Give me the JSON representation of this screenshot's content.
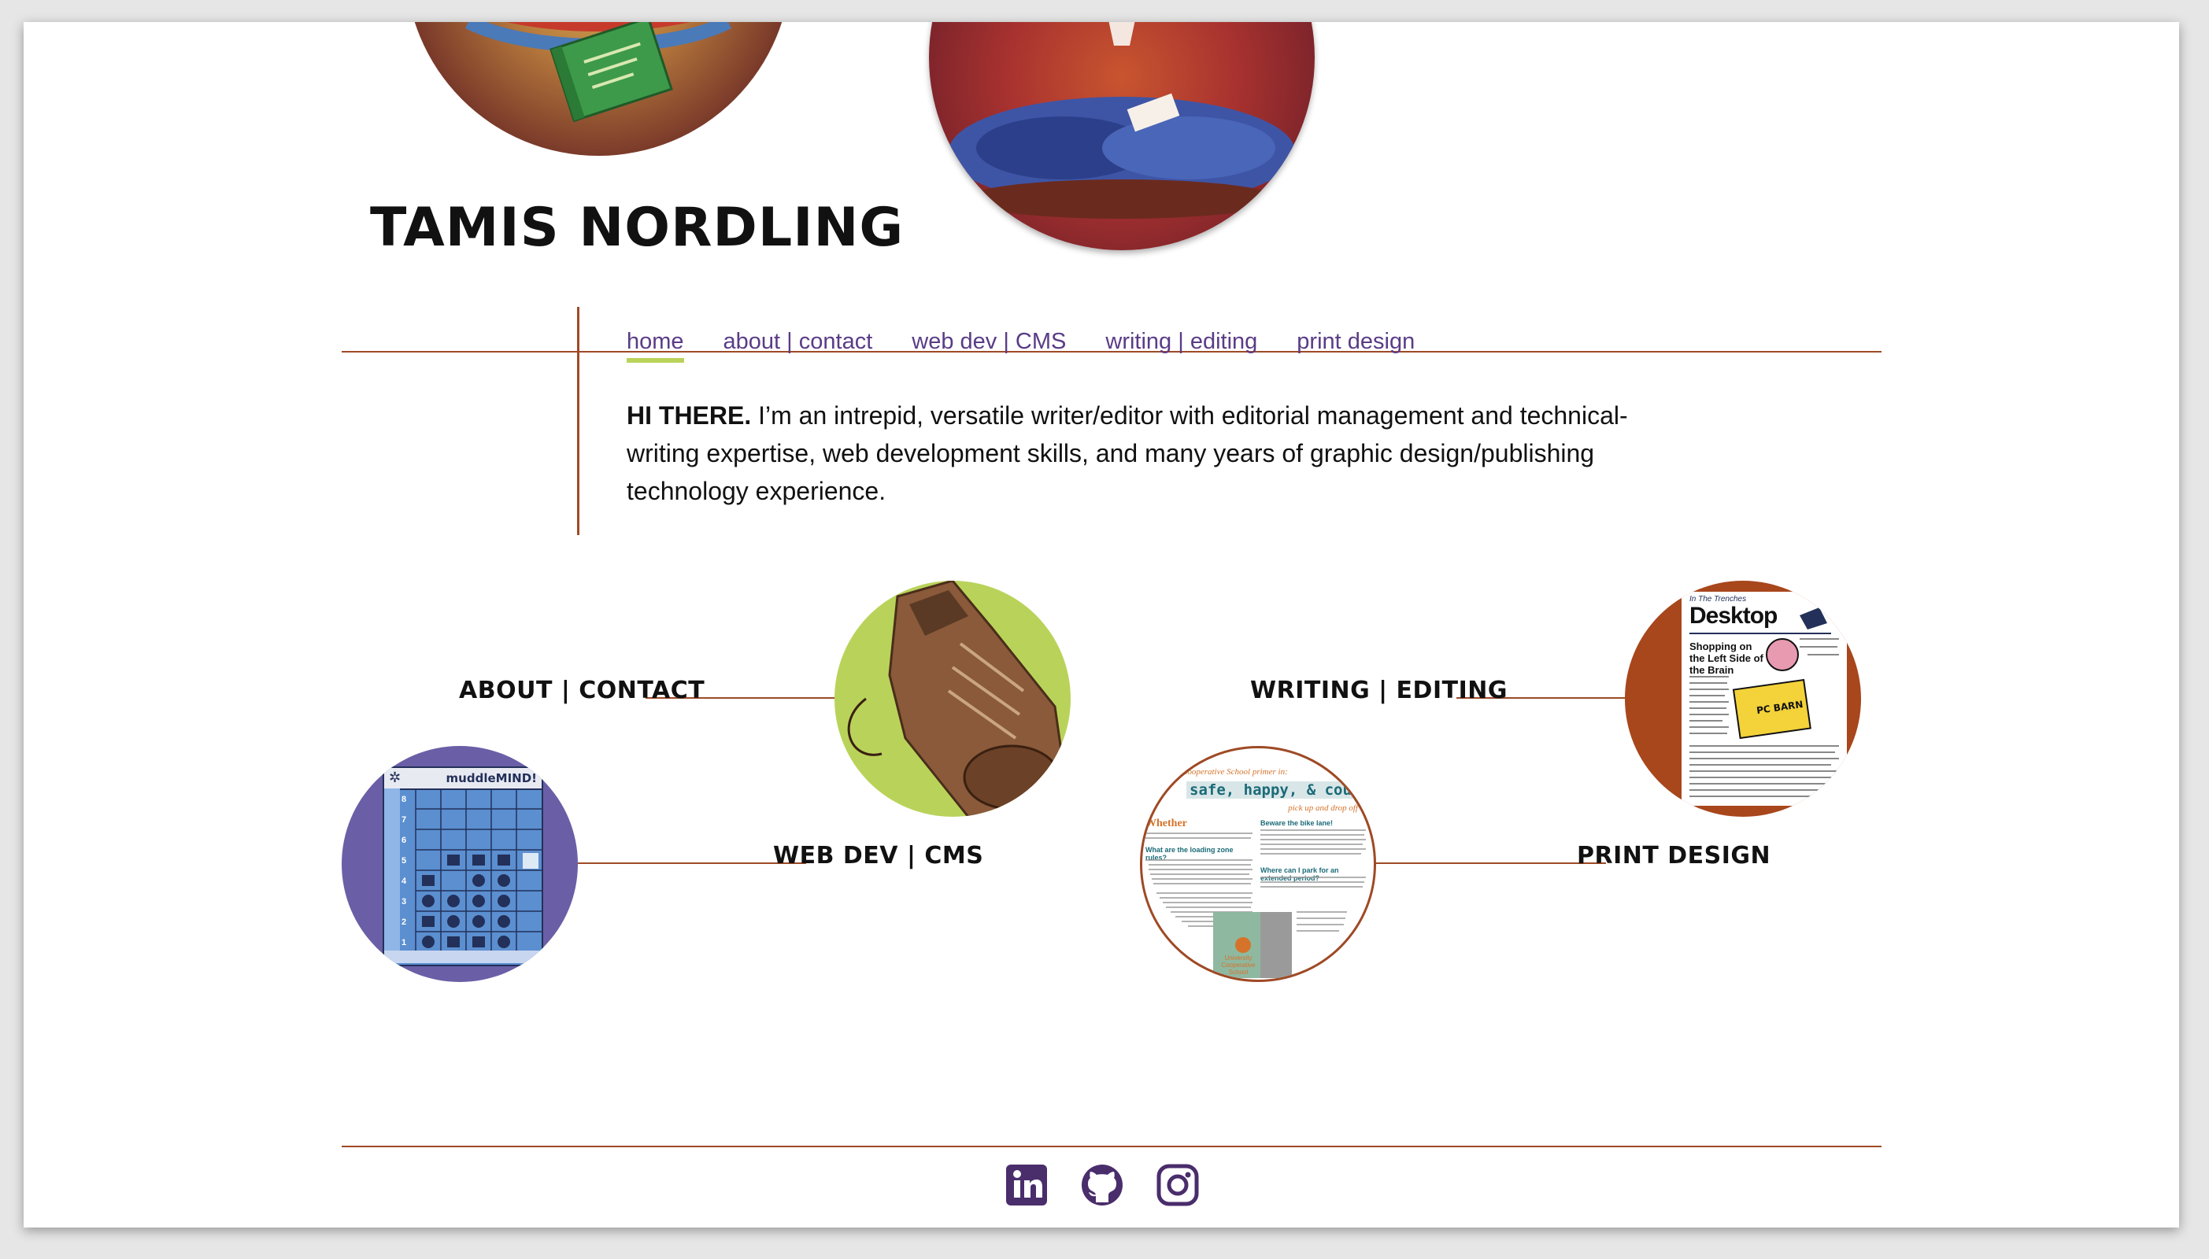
{
  "header": {
    "title": "TAMIS NORDLING"
  },
  "nav": {
    "items": [
      {
        "label": "home",
        "active": true
      },
      {
        "label": "about | contact",
        "active": false
      },
      {
        "label": "web dev | CMS",
        "active": false
      },
      {
        "label": "writing | editing",
        "active": false
      },
      {
        "label": "print design",
        "active": false
      }
    ]
  },
  "intro": {
    "lead": "HI THERE.",
    "text": " I’m an intrepid, versatile writer/editor with editorial management and technical-writing expertise, web development skills, and many years of graphic design/publishing technology experience."
  },
  "sections": {
    "about": {
      "label": "ABOUT | CONTACT"
    },
    "webdev": {
      "label": "WEB DEV | CMS"
    },
    "writing": {
      "label": "WRITING | EDITING"
    },
    "print": {
      "label": "PRINT DESIGN"
    }
  },
  "thumbnails": {
    "muddlemind": {
      "title": "muddleMIND!",
      "row_numbers": [
        "8",
        "7",
        "6",
        "5",
        "4",
        "3",
        "2",
        "1"
      ]
    },
    "desktop": {
      "kicker": "In The Trenches",
      "title": "Desktop",
      "headline": "Shopping on the Left Side of the Brain",
      "badge": "PC BARN"
    },
    "brochure": {
      "kicker": "Cooperative School primer in:",
      "title": "safe, happy, & courteous",
      "subtitle": "pick up and drop off",
      "lead": "Whether",
      "q1": "What are the loading zone rules?",
      "q2": "Beware the bike lane!",
      "q3": "Where can I park for an extended period?",
      "footer": "University Cooperative School"
    }
  },
  "social": {
    "items": [
      {
        "icon": "linkedin-icon"
      },
      {
        "icon": "github-icon"
      },
      {
        "icon": "instagram-icon"
      }
    ]
  },
  "colors": {
    "accent_line": "#9e4a26",
    "nav_link": "#5a3c86",
    "nav_active_underline": "#b9d35a",
    "icon": "#4a2d6b"
  }
}
